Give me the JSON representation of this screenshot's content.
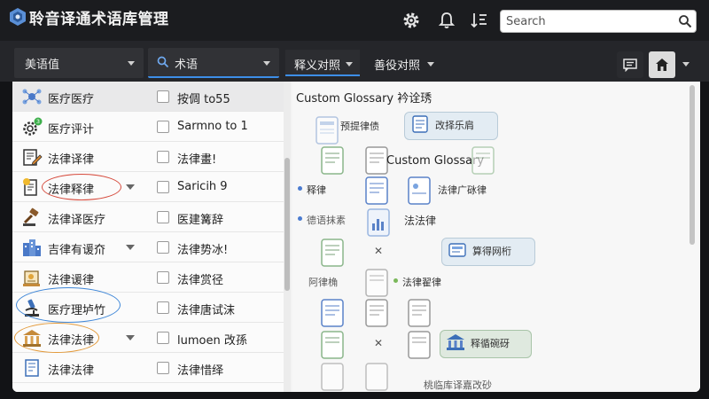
{
  "app": {
    "title": "聆音译通术语库管理"
  },
  "search": {
    "placeholder": "Search"
  },
  "toolbar": {
    "dropdown_left": "美语值",
    "dropdown_term": "术语",
    "tab_translation": "释义对照",
    "tab_bilingual": "善役对照"
  },
  "rows": [
    {
      "name": "医疗医疗",
      "value": "按倜 to55",
      "icon": "network-icon",
      "expand": false,
      "checked": false
    },
    {
      "name": "医疗评计",
      "value": "Sarmno to 1",
      "icon": "gear-badge-icon",
      "badge": "3",
      "expand": false,
      "checked": false
    },
    {
      "name": "法律译律",
      "value": "法律畫!",
      "icon": "edit-document-icon",
      "expand": false,
      "checked": false
    },
    {
      "name": "法律释律",
      "value": "Saricih 9",
      "icon": "certificate-icon",
      "expand": true,
      "checked": false
    },
    {
      "name": "法律译医疗",
      "value": "医建篝辞",
      "icon": "gavel-icon",
      "expand": false,
      "checked": false
    },
    {
      "name": "吉律有谖夼",
      "value": "法律势冰!",
      "icon": "buildings-icon",
      "expand": true,
      "checked": false
    },
    {
      "name": "法律谖律",
      "value": "法律赏径",
      "icon": "scroll-icon",
      "expand": false,
      "checked": false
    },
    {
      "name": "医疗理垆竹",
      "value": "法律唐试沫",
      "icon": "microscope-icon",
      "expand": false,
      "checked": false
    },
    {
      "name": "法律法律",
      "value": "lumoen 改孫",
      "icon": "courthouse-icon",
      "expand": true,
      "checked": false
    },
    {
      "name": "法律法律",
      "value": "法律惜绎",
      "icon": "document-list-icon",
      "expand": false,
      "checked": false
    }
  ],
  "glossary": {
    "title": "Custom Glossary  衿诠琇",
    "subtitle": "Custom Glossary",
    "labels": {
      "l1": "预提律债",
      "l2": "改择乐肩",
      "l3": "释律",
      "l4": "法律",
      "l5": "法律广砯律",
      "l6": "德语抹素",
      "l7": "法法律",
      "l8": "算得网桁",
      "l9": "阿律桷",
      "l10": "法律翟律",
      "l11": "释循碗砑",
      "l12": "桃临库译嘉改砂"
    }
  },
  "colors": {
    "accent": "#3d8ee8",
    "topbar": "#1b1c1f",
    "panel": "#f4f4f4"
  }
}
